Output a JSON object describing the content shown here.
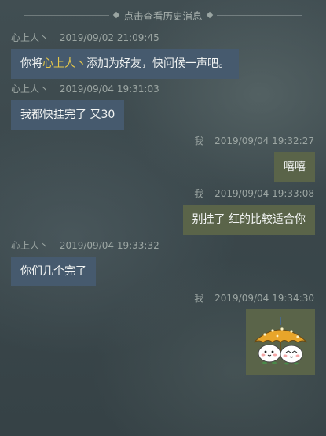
{
  "history_label": "点击查看历史消息",
  "messages": [
    {
      "side": "left",
      "name": "心上人丶",
      "time": "2019/09/02  21:09:45",
      "text_before": "你将",
      "text_highlight": "心上人丶",
      "text_after": "添加为好友，快问候一声吧。"
    },
    {
      "side": "left",
      "name": "心上人丶",
      "time": "2019/09/04  19:31:03",
      "text": "我都快挂完了 又30"
    },
    {
      "side": "right",
      "name": "我",
      "time": "2019/09/04  19:32:27",
      "text": "嘻嘻"
    },
    {
      "side": "right",
      "name": "我",
      "time": "2019/09/04  19:33:08",
      "text": "别挂了 红的比较适合你"
    },
    {
      "side": "left",
      "name": "心上人丶",
      "time": "2019/09/04  19:33:32",
      "text": "你们几个完了"
    },
    {
      "side": "right",
      "name": "我",
      "time": "2019/09/04  19:34:30",
      "sticker": "two-buns-under-umbrella-sticker"
    }
  ],
  "colors": {
    "left_bubble": "#465a6e",
    "right_bubble": "#5a6449",
    "highlight": "#e6c84a"
  }
}
